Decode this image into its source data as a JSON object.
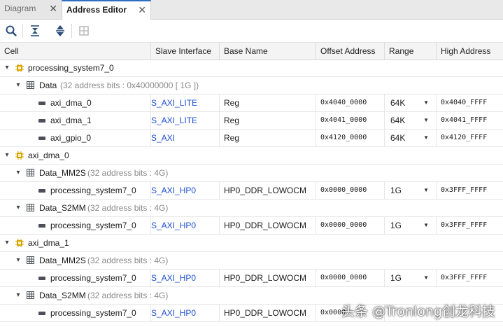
{
  "tabs": [
    {
      "label": "Diagram",
      "active": false
    },
    {
      "label": "Address Editor",
      "active": true
    }
  ],
  "toolbar": {
    "icons": [
      "search-icon",
      "collapse-all-icon",
      "expand-all-icon",
      "auto-assign-icon"
    ]
  },
  "columns": [
    "Cell",
    "Slave Interface",
    "Base Name",
    "Offset Address",
    "Range",
    "High Address"
  ],
  "tree": {
    "masters": [
      {
        "name": "processing_system7_0",
        "segments": [
          {
            "name": "Data",
            "info": "(32 address bits : 0x40000000 [ 1G ])",
            "entries": [
              {
                "cell": "axi_dma_0",
                "slave": "S_AXI_LITE",
                "base": "Reg",
                "offset": "0x4040_0000",
                "range": "64K",
                "high": "0x4040_FFFF"
              },
              {
                "cell": "axi_dma_1",
                "slave": "S_AXI_LITE",
                "base": "Reg",
                "offset": "0x4041_0000",
                "range": "64K",
                "high": "0x4041_FFFF"
              },
              {
                "cell": "axi_gpio_0",
                "slave": "S_AXI",
                "base": "Reg",
                "offset": "0x4120_0000",
                "range": "64K",
                "high": "0x4120_FFFF"
              }
            ]
          }
        ]
      },
      {
        "name": "axi_dma_0",
        "segments": [
          {
            "name": "Data_MM2S",
            "info": "(32 address bits : 4G)",
            "entries": [
              {
                "cell": "processing_system7_0",
                "slave": "S_AXI_HP0",
                "base": "HP0_DDR_LOWOCM",
                "offset": "0x0000_0000",
                "range": "1G",
                "high": "0x3FFF_FFFF"
              }
            ]
          },
          {
            "name": "Data_S2MM",
            "info": "(32 address bits : 4G)",
            "entries": [
              {
                "cell": "processing_system7_0",
                "slave": "S_AXI_HP0",
                "base": "HP0_DDR_LOWOCM",
                "offset": "0x0000_0000",
                "range": "1G",
                "high": "0x3FFF_FFFF"
              }
            ]
          }
        ]
      },
      {
        "name": "axi_dma_1",
        "segments": [
          {
            "name": "Data_MM2S",
            "info": "(32 address bits : 4G)",
            "entries": [
              {
                "cell": "processing_system7_0",
                "slave": "S_AXI_HP0",
                "base": "HP0_DDR_LOWOCM",
                "offset": "0x0000_0000",
                "range": "1G",
                "high": "0x3FFF_FFFF"
              }
            ]
          },
          {
            "name": "Data_S2MM",
            "info": "(32 address bits : 4G)",
            "entries": [
              {
                "cell": "processing_system7_0",
                "slave": "S_AXI_HP0",
                "base": "HP0_DDR_LOWOCM",
                "offset": "0x0000_",
                "range": "",
                "high": ""
              }
            ]
          }
        ]
      }
    ]
  },
  "watermark": "头条 @Tronlong创龙科技",
  "colors": {
    "link": "#1d4fd0",
    "tab_accent": "#2d6fc0",
    "cpu_icon": "#d9a400"
  }
}
